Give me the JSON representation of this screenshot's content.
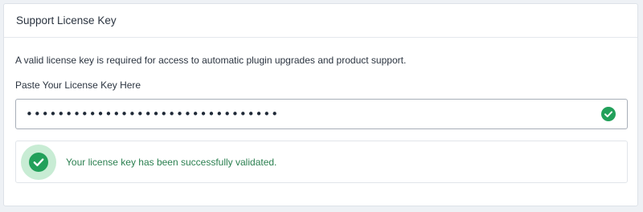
{
  "panel": {
    "title": "Support License Key"
  },
  "license": {
    "description": "A valid license key is required for access to automatic plugin upgrades and product support.",
    "field_label": "Paste Your License Key Here",
    "masked_value": "••••••••••••••••••••••••••••••••"
  },
  "alert": {
    "message": "Your license key has been successfully validated."
  },
  "icons": {
    "input_status": "check-circle-icon",
    "alert_status": "check-circle-icon"
  },
  "colors": {
    "success_green": "#22a05a",
    "success_halo": "#c8ecd4",
    "success_text": "#2a7f4f"
  }
}
